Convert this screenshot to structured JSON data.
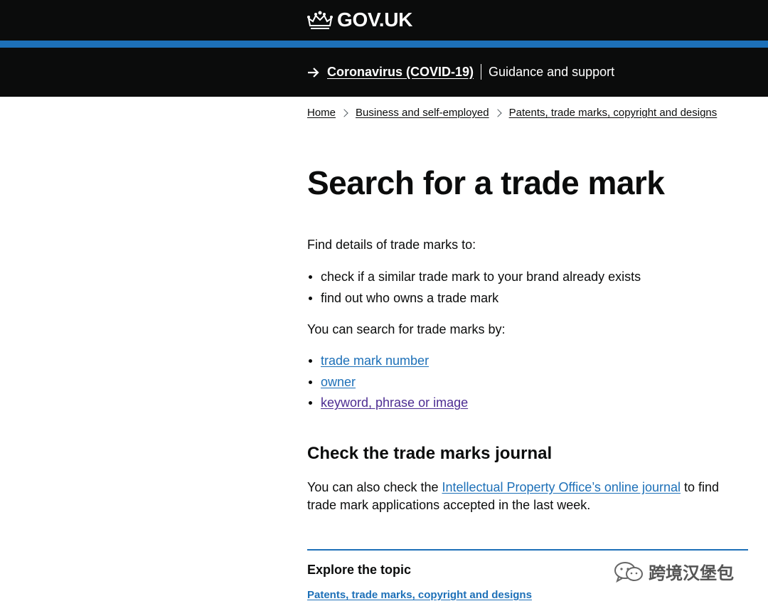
{
  "header": {
    "logo_text": "GOV.UK"
  },
  "banner": {
    "link_text": "Coronavirus (COVID-19)",
    "text": "Guidance and support"
  },
  "breadcrumb": [
    "Home",
    "Business and self-employed",
    "Patents, trade marks, copyright and designs"
  ],
  "main": {
    "title": "Search for a trade mark",
    "intro": "Find details of trade marks to:",
    "intro_list": [
      "check if a similar trade mark to your brand already exists",
      "find out who owns a trade mark"
    ],
    "search_intro": "You can search for trade marks by:",
    "search_links": [
      "trade mark number",
      "owner",
      "keyword, phrase or image"
    ],
    "journal_heading": "Check the trade marks journal",
    "journal_text_before": "You can also check the ",
    "journal_link": "Intellectual Property Office’s online journal",
    "journal_text_after": " to find trade mark applications accepted in the last week."
  },
  "explore": {
    "heading": "Explore the topic",
    "link": "Patents, trade marks, copyright and designs"
  },
  "watermark": {
    "text": "跨境汉堡包",
    "icon": "wechat-icon"
  },
  "colors": {
    "header_bg": "#0b0c0c",
    "accent_blue": "#1d70b8",
    "link": "#1d70b8",
    "visited_link": "#4c2c92",
    "text": "#0b0c0c"
  }
}
